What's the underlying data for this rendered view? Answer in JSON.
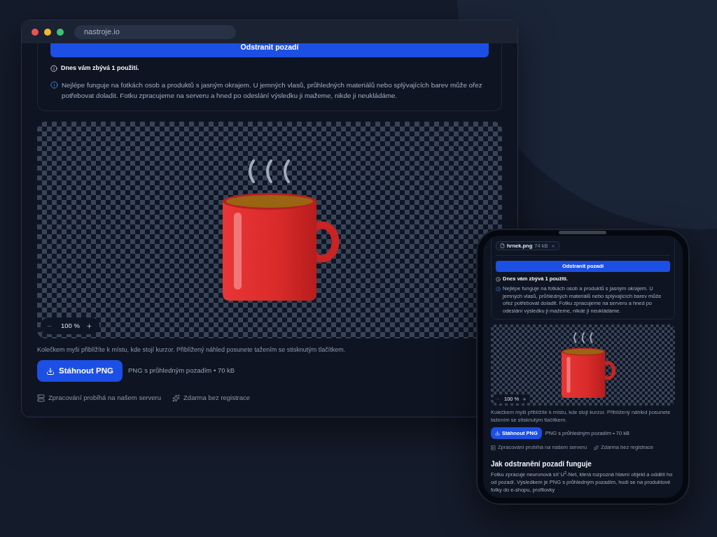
{
  "browser": {
    "address": "nastroje.io",
    "tool": {
      "remove_button": "Odstranit pozadí",
      "usage_note": "Dnes vám zbývá 1 použití.",
      "info_text": "Nejlépe funguje na fotkách osob a produktů s jasným okrajem. U jemných vlasů, průhledných materiálů nebo splývajících barev může ořez potřebovat doladit. Fotku zpracujeme na serveru a hned po odeslání výsledku ji mažeme, nikde ji neukládáme.",
      "zoom": "100 %",
      "zoom_out_disabled": true,
      "hint": "Kolečkem myši přiblížíte k místu, kde stojí kurzor. Přiblížený náhled posunete tažením se stisknutým tlačítkem.",
      "download_button": "Stáhnout PNG",
      "file_info": "PNG s průhledným pozadím • 70 kB",
      "features": [
        {
          "kind": "server",
          "label": "Zpracování probíhá na našem serveru"
        },
        {
          "kind": "sparkles",
          "label": "Zdarma bez registrace"
        }
      ]
    }
  },
  "phone": {
    "tool": {
      "file": {
        "name": "hrnek.png",
        "size": "74 kB"
      },
      "remove_button": "Odstranit pozadí",
      "usage_note": "Dnes vám zbývá 1 použití.",
      "info_text": "Nejlépe funguje na fotkách osob a produktů s jasným okrajem. U jemných vlasů, průhledných materiálů nebo splývajících barev může ořez potřebovat doladit. Fotku zpracujeme na serveru a hned po odeslání výsledku ji mažeme, nikde ji neukládáme.",
      "zoom": "100 %",
      "zoom_out_disabled": true,
      "hint": "Kolečkem myši přiblížíte k místu, kde stojí kurzor. Přiblížený náhled posunete tažením se stisknutým tlačítkem.",
      "download_button": "Stáhnout PNG",
      "file_info": "PNG s průhledným pozadím • 70 kB",
      "features": [
        {
          "kind": "server",
          "label": "Zpracování probíhá na našem serveru"
        },
        {
          "kind": "sparkles",
          "label": "Zdarma bez registrace"
        }
      ],
      "how_it_works": {
        "title": "Jak odstranění pozadí funguje",
        "text": "Fotku zpracuje neuronová síť U$^{2}$-Net, která rozpozná hlavní objekt a oddělí ho od pozadí. Výsledkem je PNG s průhledným pozadím, hodí se na produktové fotky do e-shopu, profilovky"
      }
    }
  }
}
